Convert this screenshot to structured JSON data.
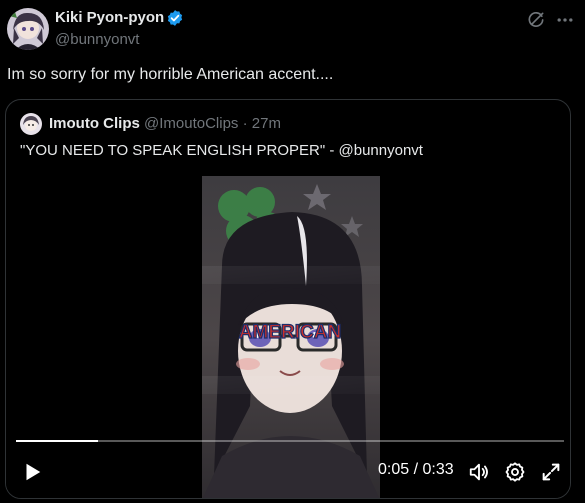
{
  "post": {
    "author_name": "Kiki Pyon-pyon",
    "author_handle": "@bunnyonvt",
    "text": "Im so sorry for my horrible American accent...."
  },
  "quote": {
    "author_name": "Imouto Clips",
    "author_handle": "@ImoutoClips",
    "separator": " · ",
    "time": "27m",
    "text": "\"YOU NEED TO SPEAK ENGLISH PROPER\" - @bunnyonvt",
    "video": {
      "overlay_text": "AMERICAN",
      "time_label": "0:05 / 0:33",
      "progress_fraction": 0.15
    }
  },
  "icons": {
    "verified": "verified-badge-icon",
    "grok": "grok-icon",
    "more": "more-icon",
    "play": "play-icon",
    "volume": "volume-icon",
    "settings": "settings-icon",
    "fullscreen": "fullscreen-icon"
  },
  "colors": {
    "background": "#000000",
    "text": "#e7e9ea",
    "secondary_text": "#71767b",
    "verified": "#1d9bf0",
    "border": "#2f3336"
  }
}
